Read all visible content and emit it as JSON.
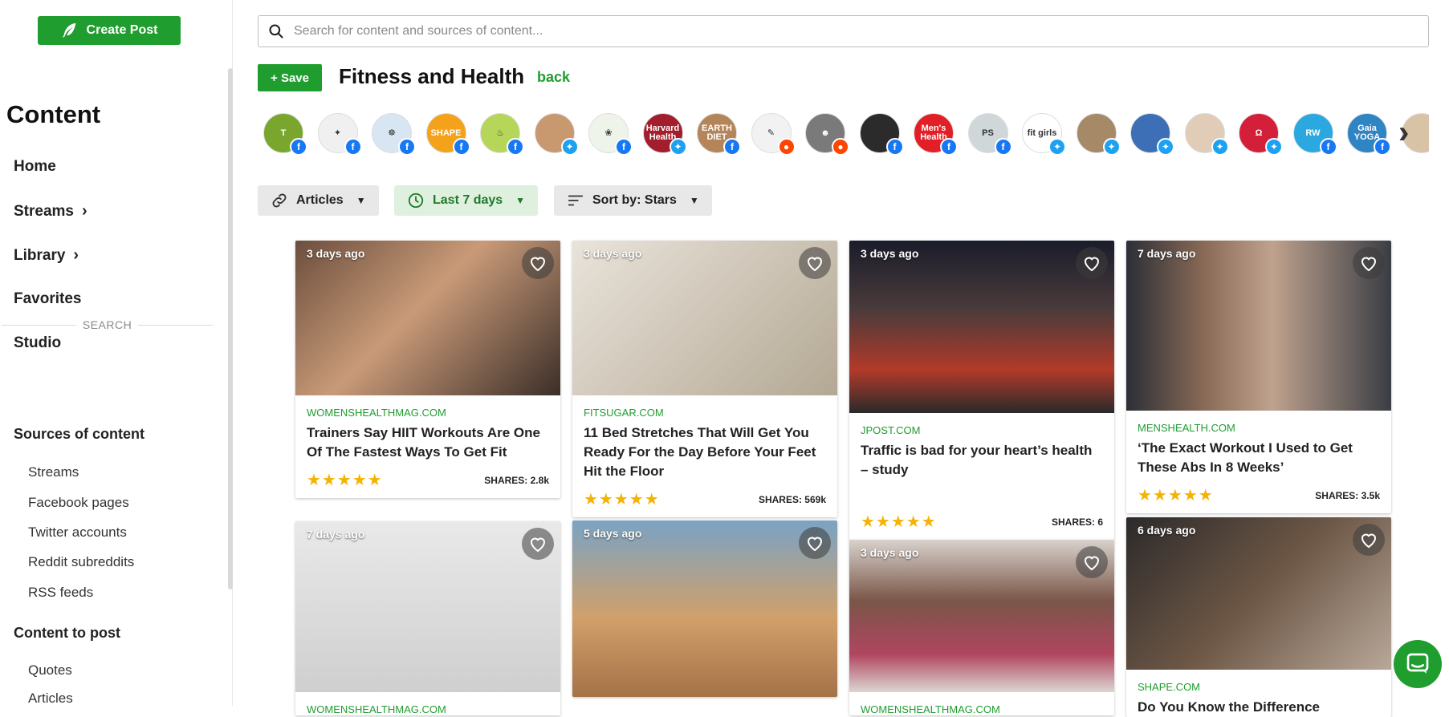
{
  "sidebar": {
    "create_post_label": "Create Post",
    "title": "Content",
    "nav": [
      {
        "label": "Home"
      },
      {
        "label": "Streams"
      },
      {
        "label": "Library"
      },
      {
        "label": "Favorites"
      },
      {
        "label": "Studio"
      }
    ],
    "search_divider": "SEARCH",
    "sources_heading": "Sources of content",
    "sources_items": [
      "Streams",
      "Facebook pages",
      "Twitter accounts",
      "Reddit subreddits",
      "RSS feeds"
    ],
    "post_heading": "Content to post",
    "post_items": [
      "Quotes",
      "Articles"
    ]
  },
  "search": {
    "placeholder": "Search for content and sources of content..."
  },
  "stream": {
    "save_label": "+ Save",
    "title": "Fitness and Health",
    "back_label": "back"
  },
  "sources": [
    {
      "icon": "nyt-logo",
      "label": "T",
      "color": "#7aa62e",
      "network": "facebook"
    },
    {
      "icon": "compass-logo",
      "label": "✦",
      "color": "#f0f0f0",
      "network": "facebook"
    },
    {
      "icon": "buddha-logo",
      "label": "☸",
      "color": "#d7e6f2",
      "network": "facebook"
    },
    {
      "icon": "shape-logo",
      "label": "SHAPE",
      "color": "#f5a21b",
      "network": "facebook"
    },
    {
      "icon": "green-fork-logo",
      "label": "♨",
      "color": "#b6d65a",
      "network": "facebook"
    },
    {
      "icon": "woman-avatar",
      "label": "",
      "color": "#c8996e",
      "network": "twitter"
    },
    {
      "icon": "wellness-logo",
      "label": "❀",
      "color": "#eef4ea",
      "network": "facebook"
    },
    {
      "icon": "harvard-health-logo",
      "label": "Harvard Health",
      "color": "#a21e2c",
      "network": "twitter"
    },
    {
      "icon": "earth-diet-logo",
      "label": "EARTH DIET",
      "color": "#b5855a",
      "network": "facebook"
    },
    {
      "icon": "sketch-logo",
      "label": "✎",
      "color": "#f2f2f2",
      "network": "reddit"
    },
    {
      "icon": "reddit-robot-logo",
      "label": "☻",
      "color": "#7a7a7a",
      "network": "reddit"
    },
    {
      "icon": "muscle-bw-logo",
      "label": "",
      "color": "#2b2b2b",
      "network": "facebook"
    },
    {
      "icon": "mens-health-logo",
      "label": "Men's Health",
      "color": "#e21f26",
      "network": "facebook"
    },
    {
      "icon": "ps-logo",
      "label": "PS",
      "color": "#cfd7d8",
      "network": "facebook"
    },
    {
      "icon": "fit-bottomed-girls-logo",
      "label": "fit girls",
      "color": "#ffffff",
      "network": "twitter"
    },
    {
      "icon": "yoga-avatar",
      "label": "",
      "color": "#a68966",
      "network": "twitter"
    },
    {
      "icon": "man-avatar",
      "label": "",
      "color": "#3c6fb5",
      "network": "twitter"
    },
    {
      "icon": "woman-yoga-avatar",
      "label": "",
      "color": "#e1ccb8",
      "network": "twitter"
    },
    {
      "icon": "lululemon-logo",
      "label": "Ω",
      "color": "#d31f39",
      "network": "twitter"
    },
    {
      "icon": "rw-logo",
      "label": "RW",
      "color": "#2aa8df",
      "network": "facebook"
    },
    {
      "icon": "gaia-logo",
      "label": "Gaia YOGA",
      "color": "#2f85c4",
      "network": "facebook"
    },
    {
      "icon": "partial-logo",
      "label": "",
      "color": "#d8c3a6",
      "network": "none"
    }
  ],
  "filters": {
    "type_label": "Articles",
    "time_label": "Last 7 days",
    "sort_label": "Sort by: Stars"
  },
  "cards": [
    {
      "time": "3 days ago",
      "domain": "WOMENSHEALTHMAG.COM",
      "headline": "Trainers Say HIIT Workouts Are One Of The Fastest Ways To Get Fit",
      "stars": "★★★★★",
      "shares": "SHARES: 2.8k"
    },
    {
      "time": "3 days ago",
      "domain": "FITSUGAR.COM",
      "headline": "11 Bed Stretches That Will Get You Ready For the Day Before Your Feet Hit the Floor",
      "stars": "★★★★★",
      "shares": "SHARES: 569k"
    },
    {
      "time": "3 days ago",
      "domain": "JPOST.COM",
      "headline": "Traffic is bad for your heart’s health – study",
      "stars": "★★★★★",
      "shares": "SHARES: 6"
    },
    {
      "time": "7 days ago",
      "domain": "MENSHEALTH.COM",
      "headline": "‘The Exact Workout I Used to Get These Abs In 8 Weeks’",
      "stars": "★★★★★",
      "shares": "SHARES: 3.5k"
    },
    {
      "time": "7 days ago",
      "domain": "WOMENSHEALTHMAG.COM",
      "headline": "",
      "stars": "",
      "shares": ""
    },
    {
      "time": "5 days ago",
      "domain": "",
      "headline": "",
      "stars": "",
      "shares": ""
    },
    {
      "time": "3 days ago",
      "domain": "WOMENSHEALTHMAG.COM",
      "headline": "",
      "stars": "",
      "shares": ""
    },
    {
      "time": "6 days ago",
      "domain": "SHAPE.COM",
      "headline": "Do You Know the Difference",
      "stars": "",
      "shares": ""
    }
  ],
  "colors": {
    "brand_green": "#1f9d2e",
    "facebook": "#1877f2",
    "twitter": "#1da1f2",
    "reddit": "#ff4500",
    "star": "#f5b301"
  }
}
